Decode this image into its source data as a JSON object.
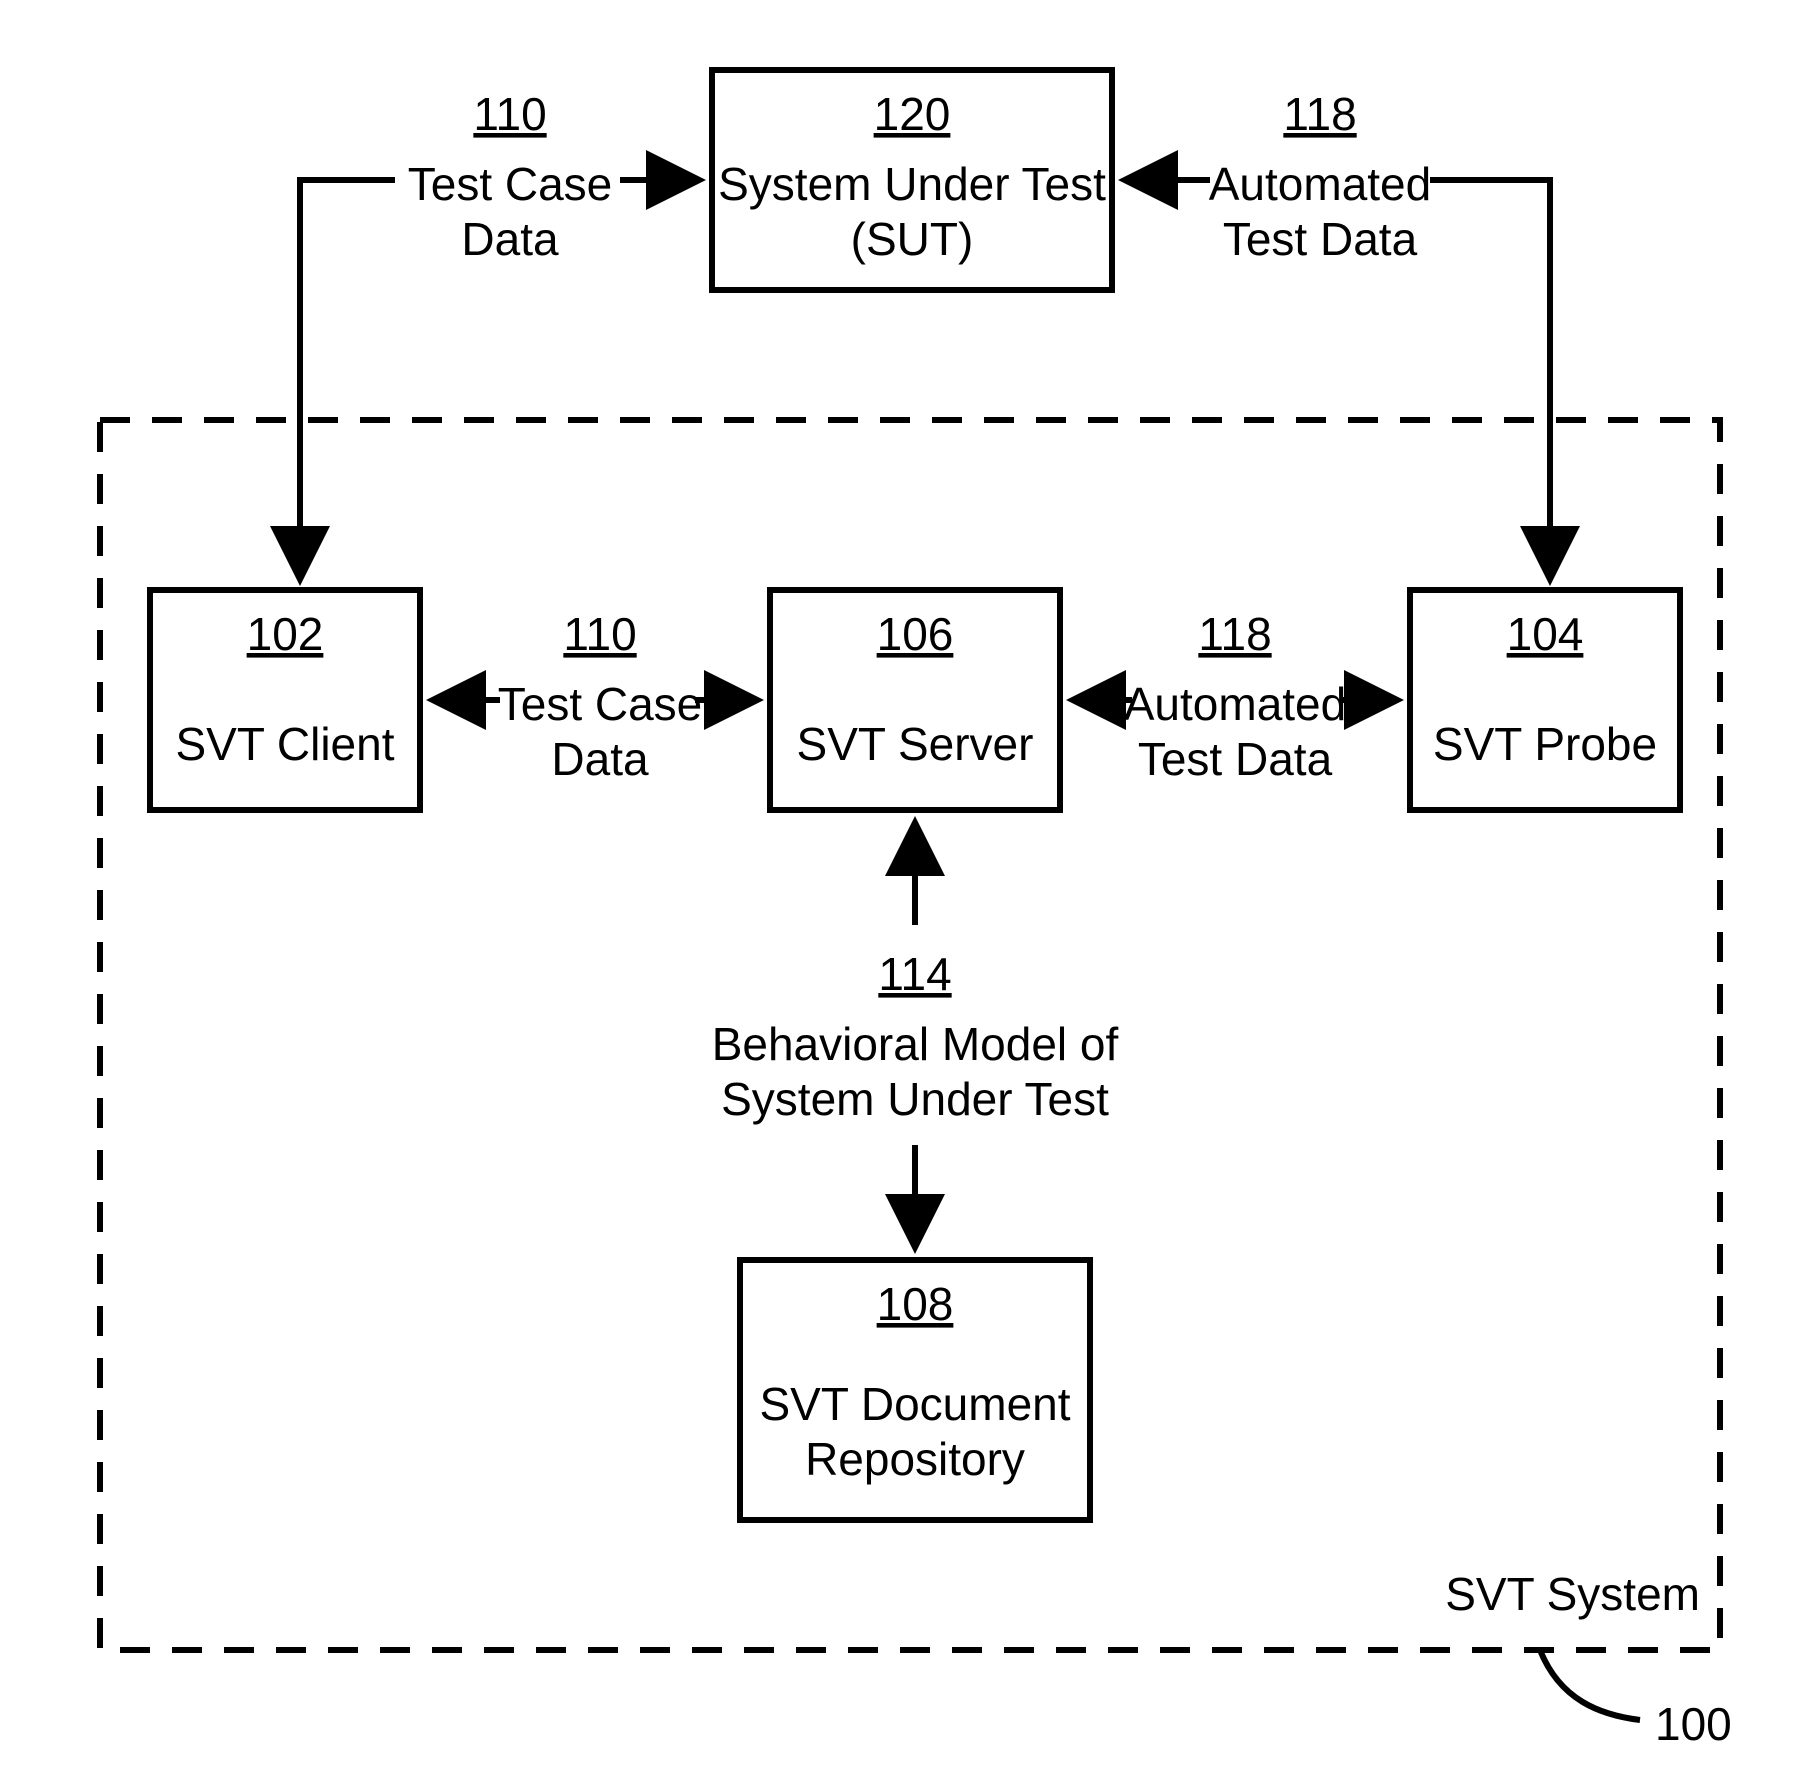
{
  "blocks": {
    "sut": {
      "ref": "120",
      "line1": "System Under Test",
      "line2": "(SUT)"
    },
    "client": {
      "ref": "102",
      "line1": "SVT Client"
    },
    "server": {
      "ref": "106",
      "line1": "SVT Server"
    },
    "probe": {
      "ref": "104",
      "line1": "SVT Probe"
    },
    "repo": {
      "ref": "108",
      "line1": "SVT Document",
      "line2": "Repository"
    }
  },
  "labels": {
    "tcd_top": {
      "ref": "110",
      "line1": "Test Case",
      "line2": "Data"
    },
    "atd_top": {
      "ref": "118",
      "line1": "Automated",
      "line2": "Test Data"
    },
    "tcd_mid": {
      "ref": "110",
      "line1": "Test Case",
      "line2": "Data"
    },
    "atd_mid": {
      "ref": "118",
      "line1": "Automated",
      "line2": "Test Data"
    },
    "bm": {
      "ref": "114",
      "line1": "Behavioral Model of",
      "line2": "System Under Test"
    }
  },
  "system_label": "SVT System",
  "system_ref": "100"
}
